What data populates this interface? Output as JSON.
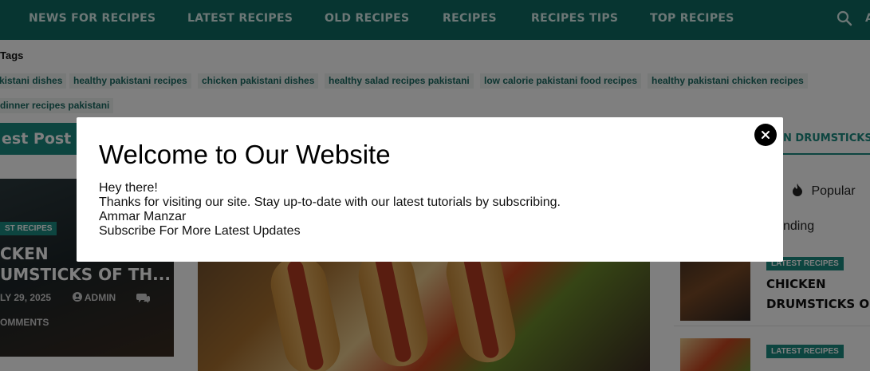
{
  "nav": {
    "items": [
      "NEWS FOR RECIPES",
      "LATEST RECIPES",
      "OLD RECIPES",
      "RECIPES",
      "RECIPES TIPS",
      "TOP RECIPES"
    ],
    "search_icon": "search-icon",
    "extra": "A"
  },
  "tags": {
    "title": "Tags",
    "items": [
      "kistani dishes",
      "healthy pakistani recipes",
      "chicken pakistani dishes",
      "healthy salad recipes pakistani",
      "low calorie pakistani food recipes",
      "healthy pakistani chicken recipes",
      "dinner recipes pakistani"
    ]
  },
  "section": {
    "title": "est Post",
    "ticker": "N DRUMSTICKS O"
  },
  "left_card": {
    "badge": "ST RECIPES",
    "title_line1": "CKEN",
    "title_line2": "UMSTICKS OF TH...",
    "date": "LY 29, 2025",
    "author": "ADMIN",
    "comments": "OMMENTS"
  },
  "sidebar": {
    "popular": "Popular",
    "trending": "nding",
    "posts": [
      {
        "badge": "LATEST RECIPES",
        "title_line1": "CHICKEN",
        "title_line2": "DRUMSTICKS O..."
      },
      {
        "badge": "LATEST RECIPES",
        "title_line1": "",
        "title_line2": ""
      }
    ]
  },
  "modal": {
    "title": "Welcome to Our Website",
    "lines": [
      "Hey there!",
      "Thanks for visiting our site. Stay up-to-date with our latest tutorials by subscribing.",
      "Ammar Manzar",
      "Subscribe For More Latest Updates"
    ],
    "close_icon": "close-icon"
  },
  "colors": {
    "nav_bg": "#0f6b63",
    "accent": "#1a8b80",
    "overlay": "rgba(0,0,0,0.5)"
  }
}
